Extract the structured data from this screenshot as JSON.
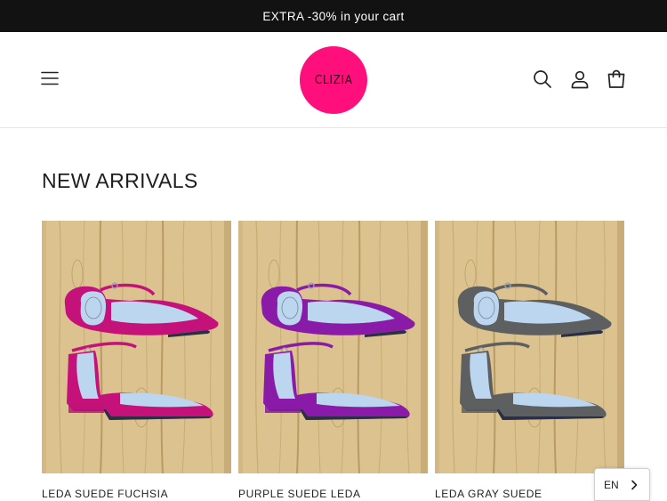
{
  "announcement": {
    "text": "EXTRA -30% in your cart"
  },
  "header": {
    "logo_text": "CLIZIA",
    "icons": {
      "menu": "hamburger-icon",
      "search": "search-icon",
      "account": "user-icon",
      "cart": "cart-icon"
    }
  },
  "section": {
    "title": "NEW ARRIVALS"
  },
  "products": [
    {
      "title": "LEDA SUEDE FUCHSIA",
      "color": "#c4127a"
    },
    {
      "title": "PURPLE SUEDE LEDA",
      "color": "#8a1aa8"
    },
    {
      "title": "LEDA GRAY SUEDE",
      "color": "#5d5f61"
    }
  ],
  "language": {
    "code": "EN"
  },
  "colors": {
    "announcement_bg": "#121212",
    "logo_bg": "#ff0f7b",
    "wood": "#dcc28e",
    "insole": "#bcd6ef"
  }
}
